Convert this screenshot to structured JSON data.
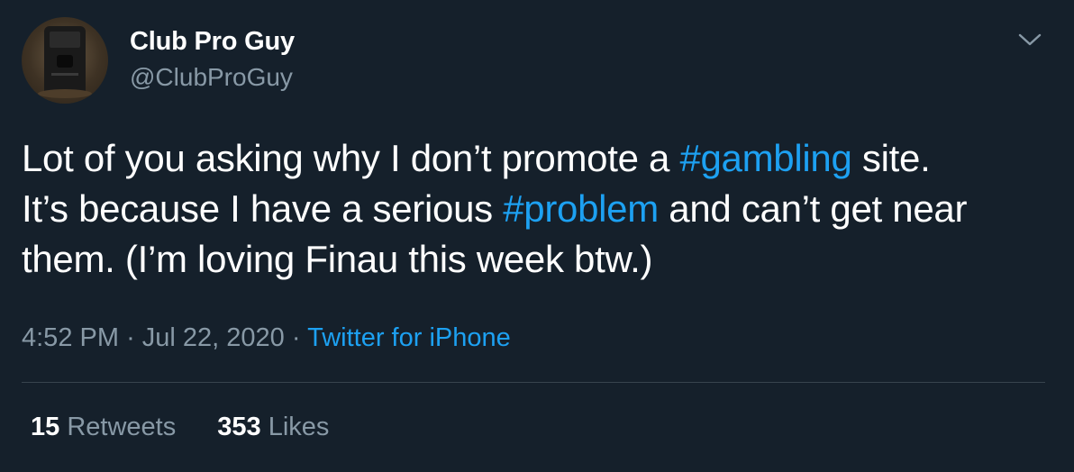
{
  "author": {
    "name": "Club Pro Guy",
    "handle": "@ClubProGuy"
  },
  "tweet": {
    "lines": [
      [
        {
          "text": "Lot of you asking why I don’t promote a ",
          "hashtag": false
        },
        {
          "text": "#gambling",
          "hashtag": true
        },
        {
          "text": " site.",
          "hashtag": false
        }
      ],
      [
        {
          "text": "It’s because I have a serious ",
          "hashtag": false
        },
        {
          "text": "#problem",
          "hashtag": true
        },
        {
          "text": " and can’t get near",
          "hashtag": false
        }
      ],
      [
        {
          "text": "them. (I’m loving Finau this week btw.)",
          "hashtag": false
        }
      ]
    ]
  },
  "meta": {
    "time": "4:52 PM",
    "separator": "·",
    "date": "Jul 22, 2020",
    "source": "Twitter for iPhone"
  },
  "stats": {
    "retweets_count": "15",
    "retweets_label": "Retweets",
    "likes_count": "353",
    "likes_label": "Likes"
  },
  "colors": {
    "background": "#15202b",
    "accent": "#1da1f2",
    "secondary_text": "#8899a6",
    "divider": "#38444d"
  },
  "icons": {
    "menu": "chevron-down-icon"
  }
}
